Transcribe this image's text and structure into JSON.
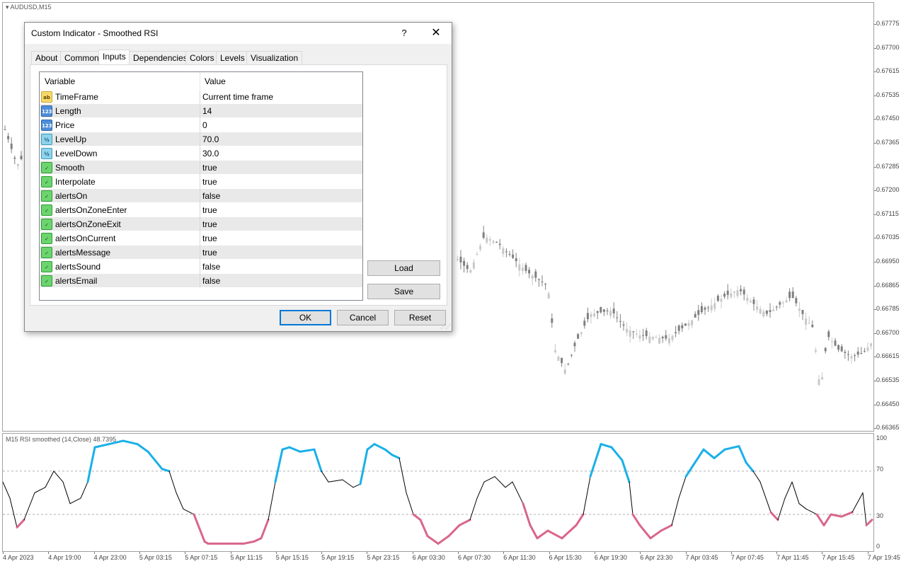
{
  "chart": {
    "title": "AUDUSD,M15",
    "price_labels": [
      "0.67775",
      "0.67700",
      "0.67615",
      "0.67535",
      "0.67450",
      "0.67365",
      "0.67285",
      "0.67200",
      "0.67115",
      "0.67035",
      "0.66950",
      "0.66865",
      "0.66785",
      "0.66700",
      "0.66615",
      "0.66535",
      "0.66450",
      "0.66365"
    ],
    "time_labels": [
      "4 Apr 2023",
      "4 Apr 19:00",
      "4 Apr 23:00",
      "5 Apr 03:15",
      "5 Apr 07:15",
      "5 Apr 11:15",
      "5 Apr 15:15",
      "5 Apr 19:15",
      "5 Apr 23:15",
      "6 Apr 03:30",
      "6 Apr 07:30",
      "6 Apr 11:30",
      "6 Apr 15:30",
      "6 Apr 19:30",
      "6 Apr 23:30",
      "7 Apr 03:45",
      "7 Apr 07:45",
      "7 Apr 11:45",
      "7 Apr 15:45",
      "7 Apr 19:45"
    ],
    "candle_color": "#808080",
    "candle_light_color": "#c8c8c8"
  },
  "indicator": {
    "title": "M15 RSI smoothed (14,Close) 48.7395",
    "levels": [
      "100",
      "70",
      "30",
      "0"
    ],
    "up_color": "#1ab0e8",
    "down_color": "#d9668a",
    "line_color": "#000000"
  },
  "dialog": {
    "title": "Custom Indicator - Smoothed RSI",
    "help": "?",
    "close": "✕",
    "tabs": [
      "About",
      "Common",
      "Inputs",
      "Dependencies",
      "Colors",
      "Levels",
      "Visualization"
    ],
    "active_tab": "Inputs",
    "columns": [
      "Variable",
      "Value"
    ],
    "rows": [
      {
        "icon": "string-icon",
        "icon_text": "ab",
        "name": "TimeFrame",
        "value": "Current time frame"
      },
      {
        "icon": "int-icon",
        "icon_text": "123",
        "name": "Length",
        "value": "14"
      },
      {
        "icon": "int-icon",
        "icon_text": "123",
        "name": "Price",
        "value": "0"
      },
      {
        "icon": "double-icon",
        "icon_text": "½",
        "name": "LevelUp",
        "value": "70.0"
      },
      {
        "icon": "double-icon",
        "icon_text": "½",
        "name": "LevelDown",
        "value": "30.0"
      },
      {
        "icon": "bool-icon",
        "icon_text": "✓",
        "name": "Smooth",
        "value": "true"
      },
      {
        "icon": "bool-icon",
        "icon_text": "✓",
        "name": "Interpolate",
        "value": "true"
      },
      {
        "icon": "bool-icon",
        "icon_text": "✓",
        "name": "alertsOn",
        "value": "false"
      },
      {
        "icon": "bool-icon",
        "icon_text": "✓",
        "name": "alertsOnZoneEnter",
        "value": "true"
      },
      {
        "icon": "bool-icon",
        "icon_text": "✓",
        "name": "alertsOnZoneExit",
        "value": "true"
      },
      {
        "icon": "bool-icon",
        "icon_text": "✓",
        "name": "alertsOnCurrent",
        "value": "true"
      },
      {
        "icon": "bool-icon",
        "icon_text": "✓",
        "name": "alertsMessage",
        "value": "true"
      },
      {
        "icon": "bool-icon",
        "icon_text": "✓",
        "name": "alertsSound",
        "value": "false"
      },
      {
        "icon": "bool-icon",
        "icon_text": "✓",
        "name": "alertsEmail",
        "value": "false"
      }
    ],
    "load_label": "Load",
    "save_label": "Save",
    "ok_label": "OK",
    "cancel_label": "Cancel",
    "reset_label": "Reset"
  }
}
